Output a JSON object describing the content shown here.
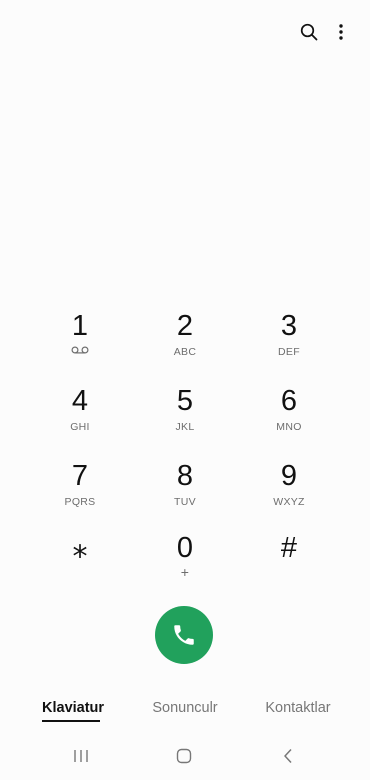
{
  "topbar": {
    "search_icon": "search-icon",
    "more_icon": "more-vertical-icon"
  },
  "keypad": {
    "keys": [
      {
        "digit": "1",
        "letters": "",
        "icon": "voicemail-icon"
      },
      {
        "digit": "2",
        "letters": "ABC"
      },
      {
        "digit": "3",
        "letters": "DEF"
      },
      {
        "digit": "4",
        "letters": "GHI"
      },
      {
        "digit": "5",
        "letters": "JKL"
      },
      {
        "digit": "6",
        "letters": "MNO"
      },
      {
        "digit": "7",
        "letters": "PQRS"
      },
      {
        "digit": "8",
        "letters": "TUV"
      },
      {
        "digit": "9",
        "letters": "WXYZ"
      },
      {
        "digit": "⁎",
        "letters": ""
      },
      {
        "digit": "0",
        "letters": "+"
      },
      {
        "digit": "#",
        "letters": ""
      }
    ]
  },
  "call": {
    "icon": "phone-icon",
    "color": "#21a15c"
  },
  "tabs": [
    {
      "label": "Klaviatur",
      "active": true
    },
    {
      "label": "Sonunculr",
      "active": false
    },
    {
      "label": "Kontaktlar",
      "active": false
    }
  ],
  "navbar": {
    "recents_icon": "recent-apps-icon",
    "home_icon": "home-icon",
    "back_icon": "back-icon"
  }
}
